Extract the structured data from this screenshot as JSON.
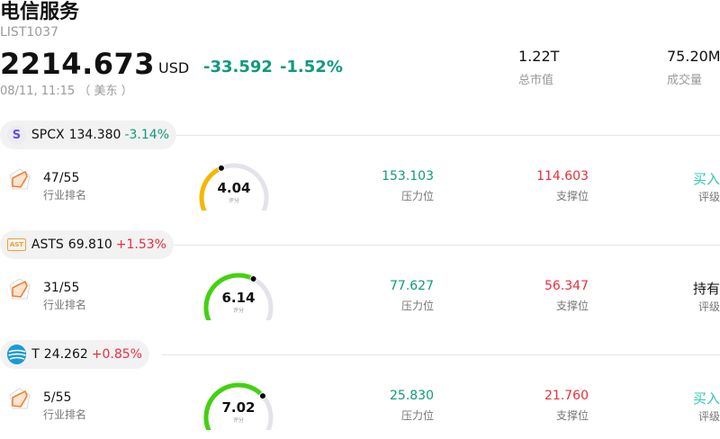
{
  "header": {
    "title": "电信服务",
    "code": "LIST1037",
    "price": "2214.673",
    "currency": "USD",
    "change": "-33.592",
    "change_pct": "-1.52%",
    "time": "08/11, 11:15 （ 美东 ）",
    "market_cap": {
      "value": "1.22T",
      "label": "总市值"
    },
    "volume": {
      "value": "75.20M",
      "label": "成交量"
    }
  },
  "stocks": [
    {
      "ticker": "SPCX",
      "price": "134.380",
      "pct": "-3.14%",
      "direction": "down",
      "logo": "S",
      "rank": "47/55",
      "rank_label": "行业排名",
      "score": "4.04",
      "score_fraction": 0.404,
      "score_caption": "评分",
      "gauge_color": "#f5b800",
      "resistance": "153.103",
      "resistance_label": "压力位",
      "support": "114.603",
      "support_label": "支撑位",
      "rating": "买入",
      "rating_label": "评级",
      "rating_type": "buy"
    },
    {
      "ticker": "ASTS",
      "price": "69.810",
      "pct": "+1.53%",
      "direction": "up",
      "logo": "AST",
      "rank": "31/55",
      "rank_label": "行业排名",
      "score": "6.14",
      "score_fraction": 0.614,
      "score_caption": "评分",
      "gauge_color": "#44d111",
      "resistance": "77.627",
      "resistance_label": "压力位",
      "support": "56.347",
      "support_label": "支撑位",
      "rating": "持有",
      "rating_label": "评级",
      "rating_type": "hold"
    },
    {
      "ticker": "T",
      "price": "24.262",
      "pct": "+0.85%",
      "direction": "up",
      "logo": "",
      "rank": "5/55",
      "rank_label": "行业排名",
      "score": "7.02",
      "score_fraction": 0.702,
      "score_caption": "评分",
      "gauge_color": "#44d111",
      "resistance": "25.830",
      "resistance_label": "压力位",
      "support": "21.760",
      "support_label": "支撑位",
      "rating": "买入",
      "rating_label": "评级",
      "rating_type": "buy"
    }
  ]
}
